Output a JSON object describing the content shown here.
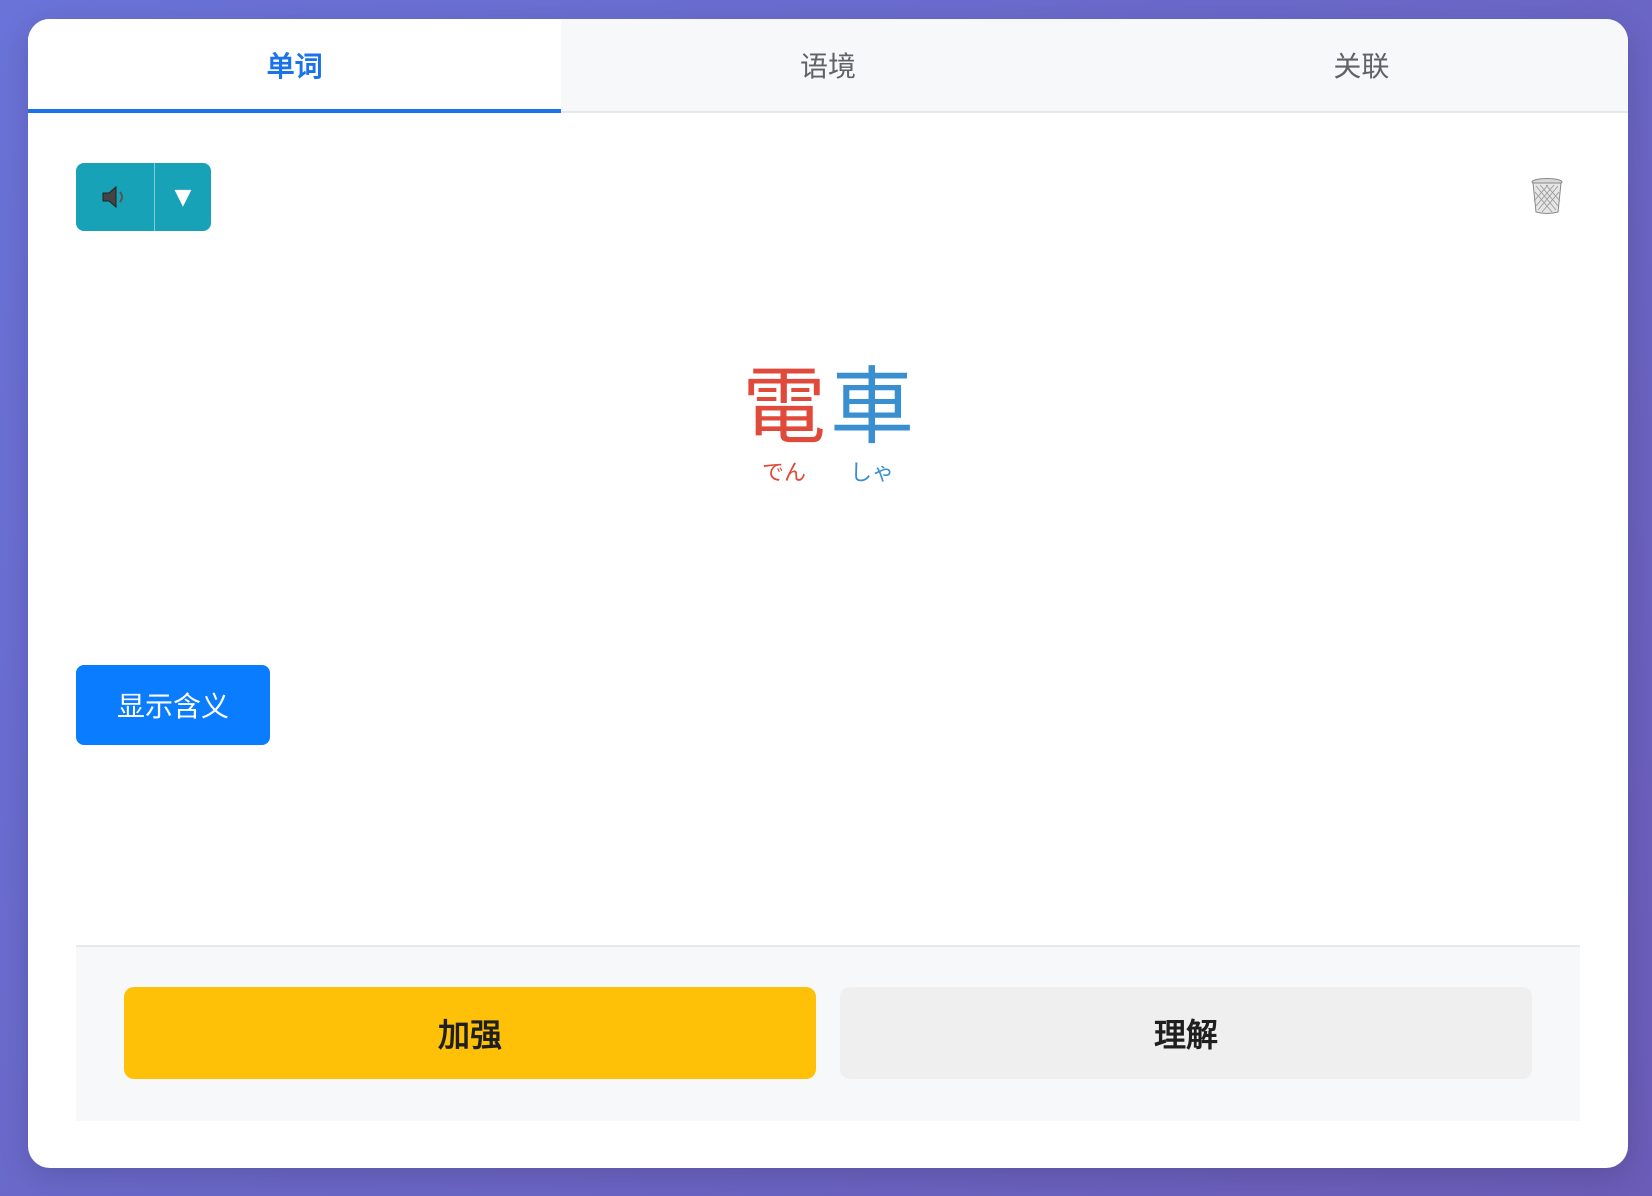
{
  "tabs": [
    {
      "label": "单词",
      "active": true
    },
    {
      "label": "语境",
      "active": false
    },
    {
      "label": "关联",
      "active": false
    }
  ],
  "audio": {
    "speaker_icon": "speaker-icon",
    "dropdown_glyph": "▼"
  },
  "word": {
    "chars": [
      {
        "kanji": "電",
        "reading": "でん",
        "color": "#e04a3a"
      },
      {
        "kanji": "車",
        "reading": "しゃ",
        "color": "#3a8fd0"
      }
    ]
  },
  "actions": {
    "show_meaning_label": "显示含义"
  },
  "footer": {
    "strengthen_label": "加强",
    "understand_label": "理解"
  },
  "colors": {
    "accent": "#1a73e8",
    "audio_button": "#17a2b8",
    "meaning_button": "#0a7cff",
    "strengthen": "#ffc107",
    "understand": "#efefef"
  }
}
